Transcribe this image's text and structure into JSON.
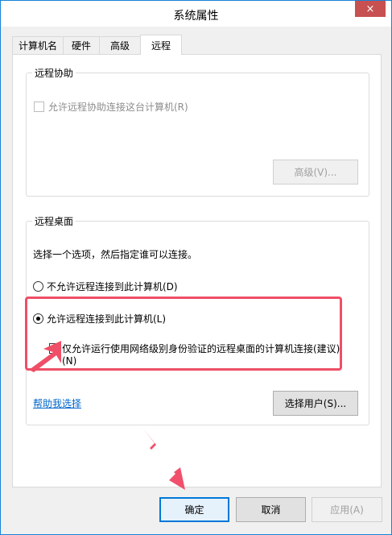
{
  "window": {
    "title": "系统属性",
    "close_icon": "×"
  },
  "tabs": [
    {
      "label": "计算机名",
      "active": false
    },
    {
      "label": "硬件",
      "active": false
    },
    {
      "label": "高级",
      "active": false
    },
    {
      "label": "远程",
      "active": true
    }
  ],
  "remote_assistance": {
    "group_title": "远程协助",
    "allow_checkbox_label": "允许远程协助连接这台计算机(R)",
    "allow_checked": false,
    "advanced_button": "高级(V)..."
  },
  "remote_desktop": {
    "group_title": "远程桌面",
    "instruction": "选择一个选项，然后指定谁可以连接。",
    "option_deny": "不允许远程连接到此计算机(D)",
    "option_allow": "允许远程连接到此计算机(L)",
    "selected": "allow",
    "nla_checkbox_line1": "仅允许运行使用网络级别身份验证的远程桌面的计算机连接(建议)",
    "nla_checkbox_line2": "(N)",
    "nla_checked": false,
    "help_link": "帮助我选择",
    "select_users_button": "选择用户(S)..."
  },
  "footer": {
    "ok_button": "确定",
    "cancel_button": "取消",
    "apply_button": "应用(A)"
  },
  "colors": {
    "accent": "#0078d7",
    "annotation": "#ef4f67",
    "close": "#c75050"
  }
}
